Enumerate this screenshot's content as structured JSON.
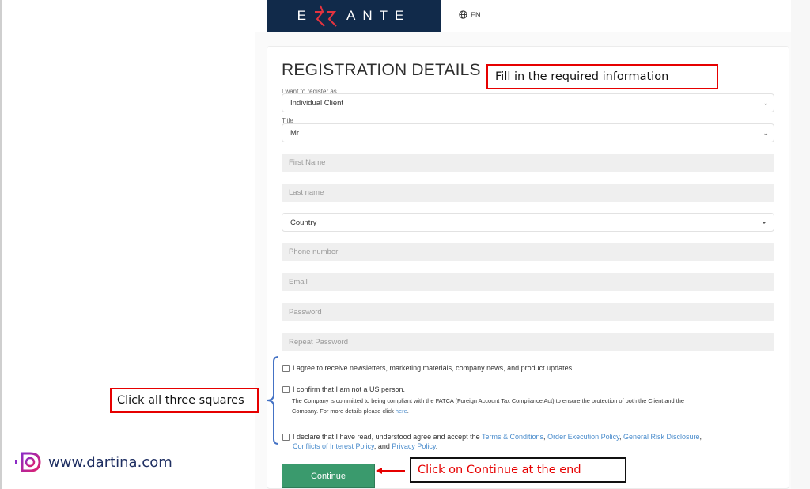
{
  "header": {
    "brand": "ERRANTE",
    "brand_prefix": "E",
    "brand_suffix": "ANTE",
    "language": "EN",
    "colors": {
      "brand_bg": "#112a4a",
      "brand_accent": "#e5333f"
    }
  },
  "form": {
    "title": "REGISTRATION DETAILS",
    "register_as": {
      "label": "I want to register as",
      "value": "Individual Client"
    },
    "title_field": {
      "label": "Title",
      "value": "Mr"
    },
    "first_name": {
      "placeholder": "First Name"
    },
    "last_name": {
      "placeholder": "Last name"
    },
    "country": {
      "value": "Country"
    },
    "phone": {
      "placeholder": "Phone number"
    },
    "email": {
      "placeholder": "Email"
    },
    "password": {
      "placeholder": "Password"
    },
    "repeat_password": {
      "placeholder": "Repeat Password"
    },
    "checkboxes": [
      {
        "label": "I agree to receive newsletters, marketing materials, company news, and product updates",
        "checked": false
      },
      {
        "label": "I confirm that I am not a US person.",
        "checked": false,
        "note": "The Company is committed to being compliant with the FATCA (Foreign Account Tax Compliance Act) to ensure the protection of both the Client and the",
        "note2": "Company. For more details please click",
        "note_link": "here",
        "note_end": "."
      },
      {
        "label": "I declare that I have read, understood agree and accept the",
        "checked": false,
        "links": [
          "Terms & Conditions",
          "Order Execution Policy",
          "General Risk Disclosure",
          "Conflicts of Interest Policy",
          "Privacy Policy"
        ],
        "sep": ", ",
        "and": ", and ",
        "end": "."
      }
    ],
    "continue_label": "Continue",
    "colors": {
      "button": "#3a9a6d",
      "link": "#4a8ccc"
    }
  },
  "annotations": {
    "fill_info": "Fill in the required information",
    "click_squares": "Click all three squares",
    "click_continue": "Click on Continue at the end",
    "colors": {
      "red": "#e60000",
      "bracket": "#4472c4"
    }
  },
  "watermark": {
    "text": "www.dartina.com"
  }
}
